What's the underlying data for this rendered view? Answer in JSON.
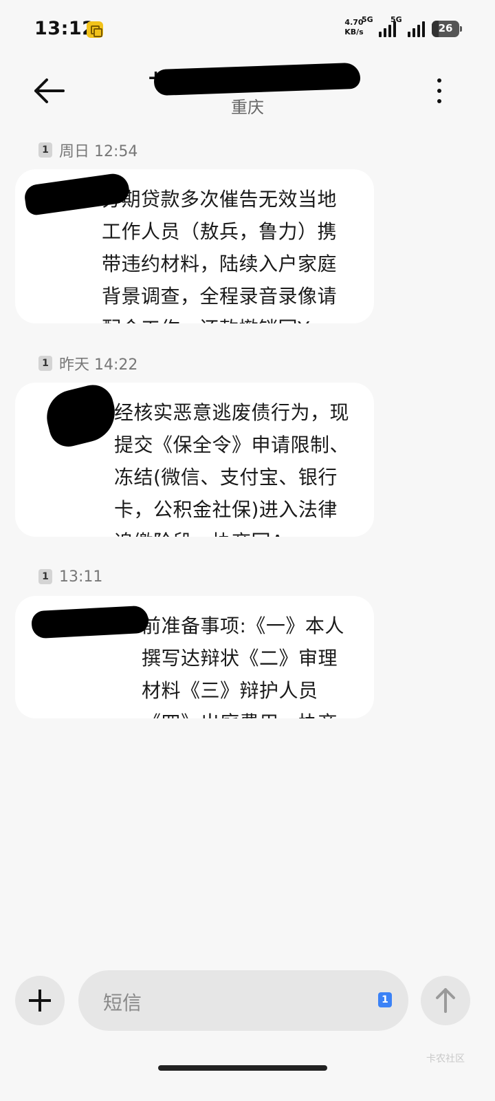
{
  "status_bar": {
    "time": "13:12",
    "net_speed_value": "4.70",
    "net_speed_unit": "KB/s",
    "signal_1": "5G",
    "signal_2": "5G",
    "battery": "26",
    "battery_level": 0.26
  },
  "header": {
    "contact_prefix": "+",
    "contact_location": "重庆"
  },
  "messages": [
    {
      "sim": "1",
      "timestamp": "周日 12:54",
      "text": "分期贷款多次催告无效当地工作人员（敖兵，鲁力）携带违约材料，陆续入户家庭背景调查，全程录音录像请配合工作，还款撤销回Y。"
    },
    {
      "sim": "1",
      "timestamp": "昨天 14:22",
      "text": "经核实恶意逃废债行为，现提交《保全令》申请限制、冻结(微信、支付宝、银行卡，公积金社保)进入法律追缴阶段，协商回A"
    },
    {
      "sim": "1",
      "timestamp": "13:11",
      "text": "前准备事项:《一》本人撰写达辩状《二》审理材料《三》辩护人员《四》出庭费用，协商回A"
    }
  ],
  "composer": {
    "placeholder": "短信",
    "sim": "1"
  },
  "watermark": "卡农社区",
  "colors": {
    "background": "#f7f7f7",
    "bubble": "#ffffff",
    "input": "#e6e6e6",
    "sim_accent": "#3b82f6",
    "notif_icon": "#f2c21a"
  },
  "icons": {
    "back": "arrow-left-icon",
    "more": "more-vertical-icon",
    "add": "plus-icon",
    "send": "arrow-up-icon"
  }
}
